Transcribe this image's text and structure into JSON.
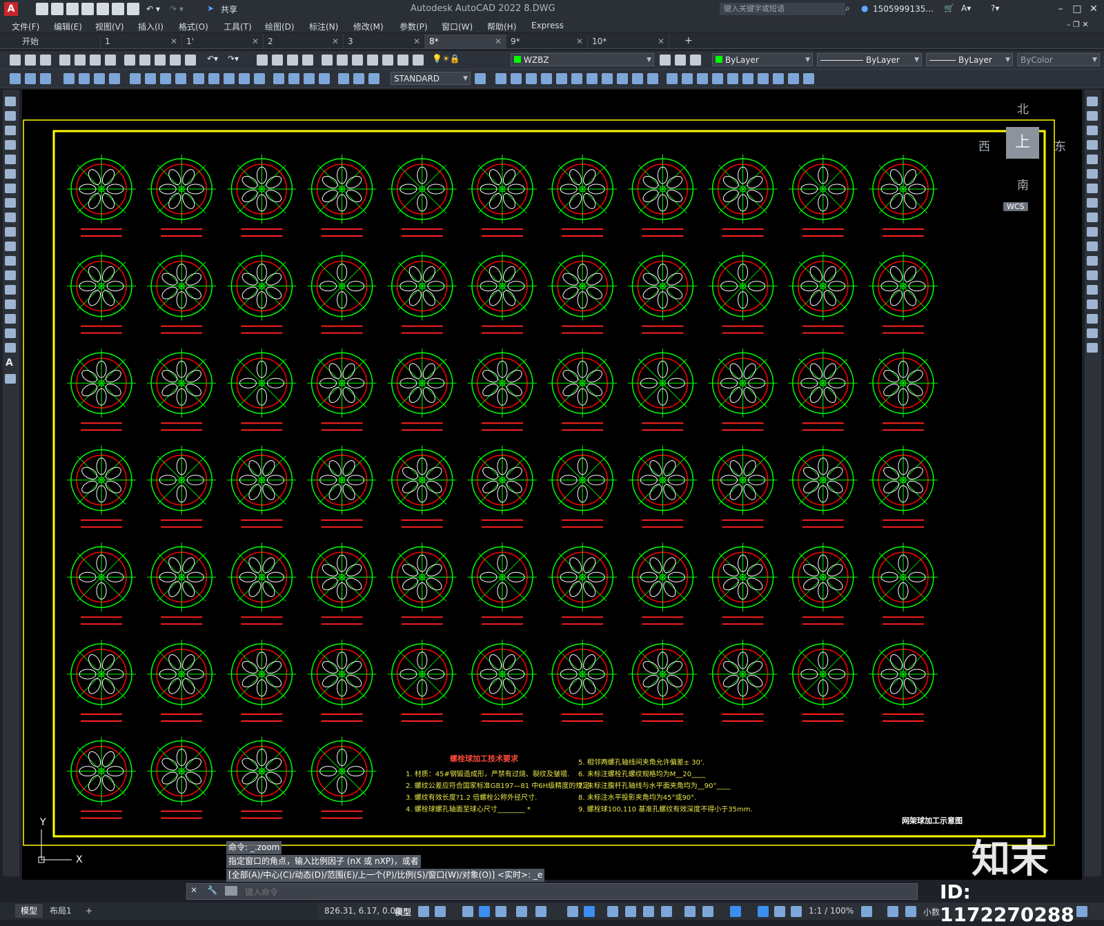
{
  "app": {
    "title": "Autodesk AutoCAD 2022    8.DWG",
    "share_label": "共享",
    "search_placeholder": "键入关键字或短语",
    "user": "1505999135...",
    "logo_letter": "A"
  },
  "menu": [
    "文件(F)",
    "编辑(E)",
    "视图(V)",
    "插入(I)",
    "格式(O)",
    "工具(T)",
    "绘图(D)",
    "标注(N)",
    "修改(M)",
    "参数(P)",
    "窗口(W)",
    "帮助(H)",
    "Express"
  ],
  "tabs": [
    {
      "label": "开始",
      "close": ""
    },
    {
      "label": "1",
      "close": "✕"
    },
    {
      "label": "1'",
      "close": "✕"
    },
    {
      "label": "2",
      "close": "✕"
    },
    {
      "label": "3",
      "close": "✕"
    },
    {
      "label": "8*",
      "close": "✕",
      "active": true
    },
    {
      "label": "9*",
      "close": "✕"
    },
    {
      "label": "10*",
      "close": "✕"
    }
  ],
  "new_tab": "+",
  "properties": {
    "layer": "WZBZ",
    "color": "ByLayer",
    "linetype": "ByLayer",
    "lineweight": "ByLayer",
    "plotstyle": "ByColor",
    "textstyle": "STANDARD"
  },
  "viewcube": {
    "north": "北",
    "south": "南",
    "east": "东",
    "west": "西",
    "top": "上",
    "wcs": "WCS"
  },
  "command": {
    "history": [
      "命令: _.zoom",
      "指定窗口的角点，输入比例因子 (nX 或 nXP)，或者",
      "[全部(A)/中心(C)/动态(D)/范围(E)/上一个(P)/比例(S)/窗口(W)/对象(O)] <实时>: _e"
    ],
    "placeholder": "键入命令"
  },
  "layout_tabs": [
    "模型",
    "布局1",
    "+"
  ],
  "status": {
    "coords": "826.31, 6.17, 0.00",
    "mode": "模型",
    "scale": "1:1 / 100%",
    "units": "小数"
  },
  "drawing": {
    "notes_title": "螺栓球加工技术要求",
    "notes_left": [
      "1. 材质：45#钢锻造成形，严禁有过烧、裂纹及皱褶.",
      "2. 螺纹公差应符合国家标准GB197—81 中6H级精度的规定.",
      "3. 螺纹有效长度?1.2 倍螺栓公称外径尺寸.",
      "4. 螺栓球螺孔轴面至球心尺寸________ *"
    ],
    "notes_right": [
      "5. 相邻两螺孔轴线间夹角允许偏差± 30'.",
      "6. 未标注螺栓孔螺纹规格均为M__20____",
      "7. 未标注腹杆孔轴线与水平面夹角均为__90°____",
      "8. 未标注水平投影夹角均为45°或90°.",
      "9. 螺栓球100,110 基准孔螺纹有效深度不得小于35mm."
    ],
    "sheet_title": "网架球加工示意图",
    "ucs_x": "X",
    "ucs_y": "Y"
  },
  "watermark": {
    "brand": "知末",
    "id": "ID: 1172270288"
  },
  "colors": {
    "canvas": "#000000",
    "frame": "#ffff00",
    "circle": "#00ff00",
    "arc": "#ff0000",
    "hole": "#ffffff",
    "label": "#ff2020"
  }
}
